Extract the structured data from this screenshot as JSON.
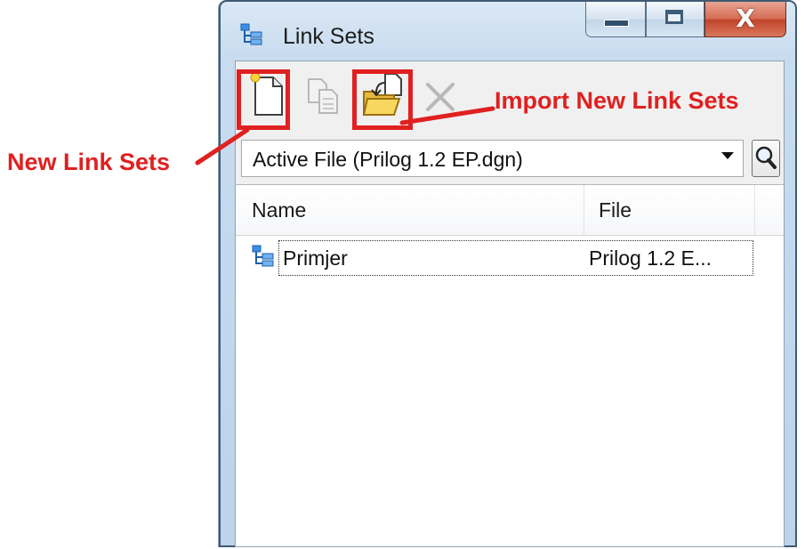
{
  "window": {
    "title": "Link Sets",
    "title_icon": "link-set-tree-icon",
    "controls": [
      "minimize-icon",
      "maximize-icon",
      "close-icon"
    ],
    "close_glyph": "X"
  },
  "toolbar": {
    "buttons": [
      {
        "name": "new-link-set",
        "icon": "new-document-icon",
        "enabled": true
      },
      {
        "name": "copy-link-set",
        "icon": "copy-icon",
        "enabled": false
      },
      {
        "name": "import-link-sets",
        "icon": "import-folder-icon",
        "enabled": true
      },
      {
        "name": "delete-link-set",
        "icon": "delete-x-icon",
        "enabled": false
      }
    ]
  },
  "filter": {
    "selected": "Active File (Prilog 1.2 EP.dgn)",
    "search_icon": "magnifier-icon"
  },
  "list": {
    "columns": [
      "Name",
      "File"
    ],
    "rows": [
      {
        "name": "Primjer",
        "file": "Prilog 1.2 E...",
        "icon": "link-set-tree-icon"
      }
    ]
  },
  "annotations": {
    "new_link_sets": "New Link Sets",
    "import_new_link_sets": "Import New Link Sets",
    "color": "#e02020"
  }
}
